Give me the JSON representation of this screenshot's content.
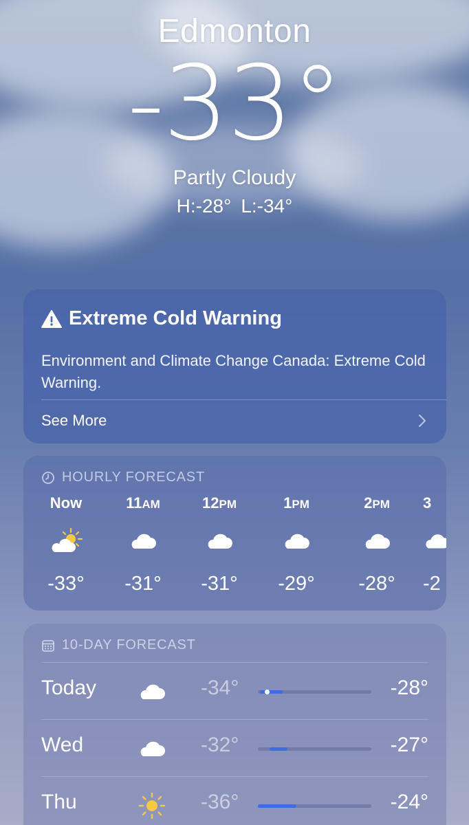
{
  "header": {
    "city": "Edmonton",
    "temperature": "-33°",
    "condition": "Partly Cloudy",
    "high": "H:-28°",
    "low": "L:-34°"
  },
  "alert": {
    "icon": "warning-triangle-icon",
    "title": "Extreme Cold Warning",
    "body": "Environment and Climate Change Canada: Extreme Cold Warning.",
    "see_more": "See More"
  },
  "hourly": {
    "heading": "HOURLY FORECAST",
    "items": [
      {
        "label": "Now",
        "suffix": "",
        "icon": "partly-cloudy-icon",
        "temp": "-33°"
      },
      {
        "label": "11",
        "suffix": "AM",
        "icon": "cloud-icon",
        "temp": "-31°"
      },
      {
        "label": "12",
        "suffix": "PM",
        "icon": "cloud-icon",
        "temp": "-31°"
      },
      {
        "label": "1",
        "suffix": "PM",
        "icon": "cloud-icon",
        "temp": "-29°"
      },
      {
        "label": "2",
        "suffix": "PM",
        "icon": "cloud-icon",
        "temp": "-28°"
      },
      {
        "label": "3",
        "suffix": "",
        "icon": "cloud-icon",
        "temp": "-2"
      }
    ]
  },
  "daily": {
    "heading": "10-DAY FORECAST",
    "items": [
      {
        "day": "Today",
        "icon": "cloud-icon",
        "low": "-34°",
        "high": "-28°",
        "range_start": 0.02,
        "range_end": 0.22,
        "current": 0.08
      },
      {
        "day": "Wed",
        "icon": "cloud-icon",
        "low": "-32°",
        "high": "-27°",
        "range_start": 0.1,
        "range_end": 0.26
      },
      {
        "day": "Thu",
        "icon": "sun-icon",
        "low": "-36°",
        "high": "-24°",
        "range_start": 0.0,
        "range_end": 0.34
      }
    ]
  },
  "colors": {
    "range_bar": "#3d6de0",
    "sun": "#f7c843"
  }
}
